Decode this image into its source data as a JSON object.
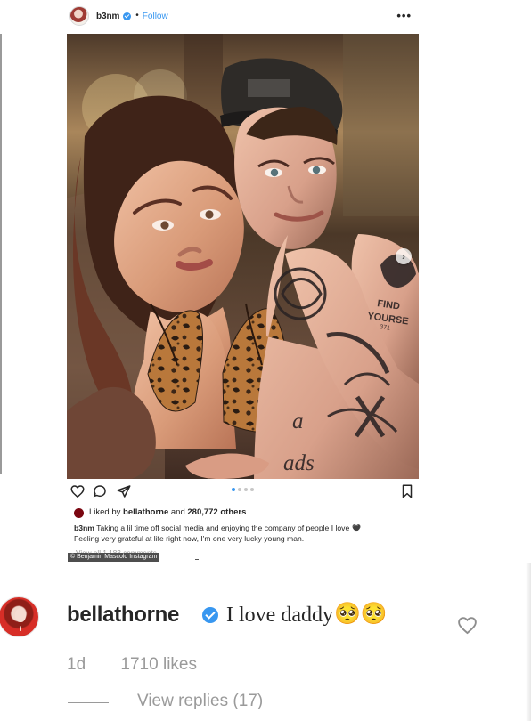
{
  "post": {
    "username": "b3nm",
    "separator": "•",
    "follow_label": "Follow",
    "more_label": "•••",
    "likes_prefix": "Liked by",
    "liked_by_user": "bellathorne",
    "likes_middle": "and",
    "likes_count": "280,772 others",
    "caption_user": "b3nm",
    "caption_line_1": "Taking a lil time off social media and enjoying the company of people I love",
    "caption_emoji": "🖤",
    "caption_line_2": "Feeling very grateful at life right now, I'm one very lucky young man.",
    "view_all_comments": "View all 1,183 comments",
    "source_label": "© Benjamin Mascolo Instagram",
    "carousel_pages": 4,
    "carousel_active_page": 1
  },
  "photo": {
    "tattoo_text_1": "FIND",
    "tattoo_text_2": "YOURSE",
    "tattoo_text_3": "371",
    "chest_tattoo_1": "a",
    "chest_tattoo_2": "ads"
  },
  "comment": {
    "username": "bellathorne",
    "text": "I love daddy",
    "emoji": "🥺🥺",
    "age": "1d",
    "likes": "1710 likes",
    "view_replies": "View replies (17)"
  },
  "icons": {
    "like": "heart-icon",
    "comment": "comment-icon",
    "share": "share-icon",
    "save": "bookmark-icon",
    "next": "chevron-right-icon",
    "more": "more-icon"
  },
  "colors": {
    "instagram_blue": "#3897f0",
    "text": "#262626",
    "muted": "#9a9a9a"
  }
}
